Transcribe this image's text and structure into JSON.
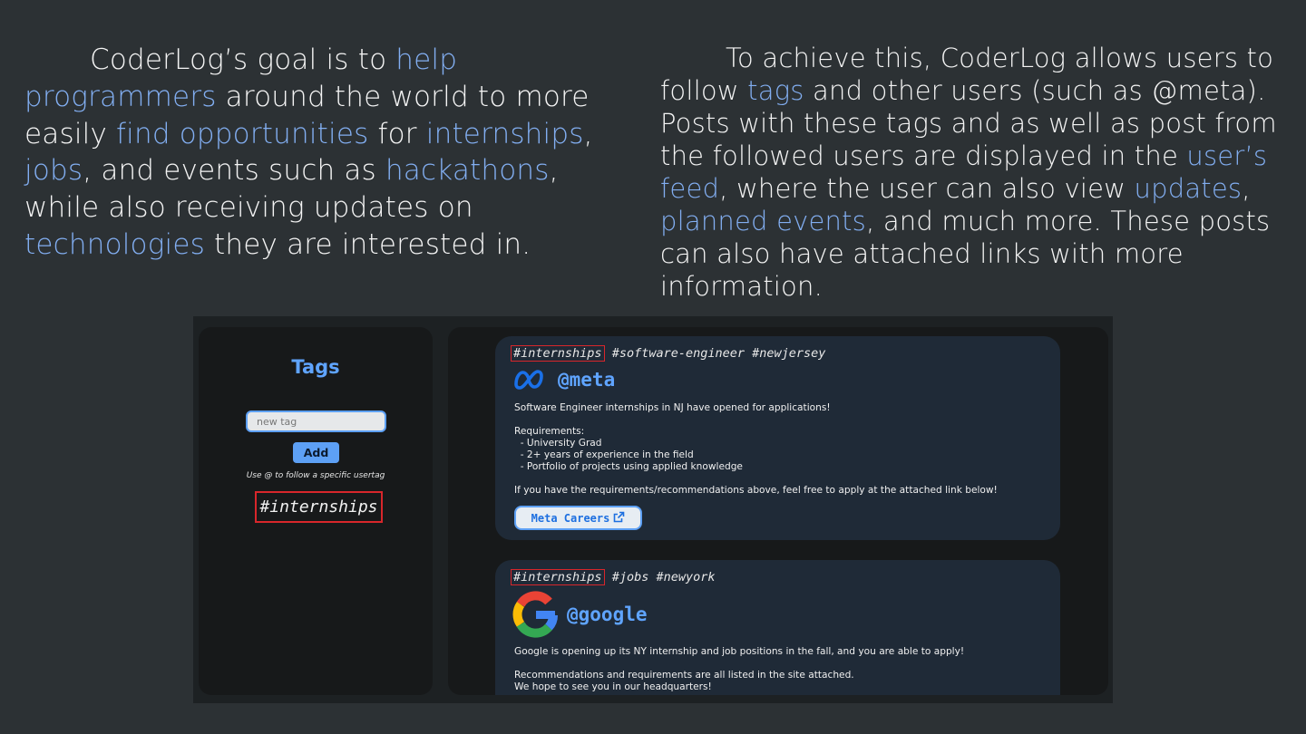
{
  "slide": {
    "left_paragraph": {
      "t1": "CoderLog’s goal is to ",
      "h1": "help programmers",
      "t2": " around the world to more easily ",
      "h2": "find opportunities",
      "t3": " for ",
      "h3": "internships",
      "t4": ", ",
      "h4": "jobs",
      "t5": ", and events such as ",
      "h5": "hackathons",
      "t6": ", while also receiving updates on ",
      "h6": "technologies",
      "t7": " they are interested in."
    },
    "right_paragraph": {
      "t1": "To achieve this, CoderLog allows users to follow ",
      "h1": "tags",
      "t2": " and other users (such as @meta). Posts with these tags and as well as post from the followed users are displayed in the ",
      "h2": "user’s feed",
      "t3": ", where the user can also view ",
      "h3": "updates",
      "t4": ", ",
      "h4": "planned events",
      "t5": ", and much more. These posts can also have attached links with more information."
    }
  },
  "tags_panel": {
    "title": "Tags",
    "input_placeholder": "new tag",
    "add_label": "Add",
    "hint": "Use @ to follow a specific usertag",
    "followed_tags": [
      "#internships"
    ]
  },
  "feed": {
    "posts": [
      {
        "tags": [
          "#internships",
          "#software-engineer",
          "#newjersey"
        ],
        "handle": "@meta",
        "logo_icon": "meta-logo-icon",
        "body": "Software Engineer internships in NJ have opened for applications!\n\nRequirements:\n  - University Grad\n  - 2+ years of experience in the field\n  - Portfolio of projects using applied knowledge\n\nIf you have the requirements/recommendations above, feel free to apply at the attached link below!",
        "link_label": "Meta Careers"
      },
      {
        "tags": [
          "#internships",
          "#jobs",
          "#newyork"
        ],
        "handle": "@google",
        "logo_icon": "google-logo-icon",
        "body": "Google is opening up its NY internship and job positions in the fall, and you are able to apply!\n\nRecommendations and requirements are all listed in the site attached.\nWe hope to see you in our headquarters!"
      }
    ]
  },
  "colors": {
    "background": "#2c3134",
    "highlight": "#82aef1",
    "accent_blue": "#5fa4ff",
    "highlight_box": "#d8262b",
    "post_bg": "#1f2a37"
  }
}
